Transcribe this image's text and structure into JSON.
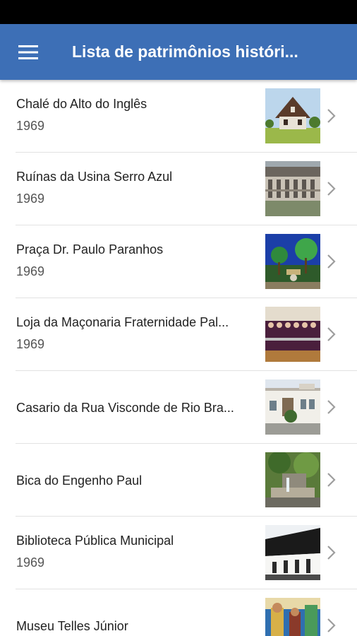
{
  "app_bar": {
    "title": "Lista de patrimônios históri...",
    "color": "#3d6fb6",
    "menu_icon": "hamburger-menu-icon"
  },
  "items": [
    {
      "title": "Chalé do Alto do Inglês",
      "year": "1969",
      "thumb_icon": "chalet-photo"
    },
    {
      "title": "Ruínas da Usina Serro Azul",
      "year": "1969",
      "thumb_icon": "ruins-photo"
    },
    {
      "title": "Praça Dr. Paulo Paranhos",
      "year": "1969",
      "thumb_icon": "square-photo"
    },
    {
      "title": "Loja da Maçonaria Fraternidade Pal...",
      "year": "1969",
      "thumb_icon": "masonic-lodge-photo"
    },
    {
      "title": "Casario da Rua Visconde de Rio Bra...",
      "year": "",
      "thumb_icon": "townhouse-photo"
    },
    {
      "title": "Bica do Engenho Paul",
      "year": "",
      "thumb_icon": "fountain-photo"
    },
    {
      "title": "Biblioteca Pública Municipal",
      "year": "1969",
      "thumb_icon": "library-photo"
    },
    {
      "title": "Museu Telles Júnior",
      "year": "",
      "thumb_icon": "museum-photo"
    }
  ]
}
